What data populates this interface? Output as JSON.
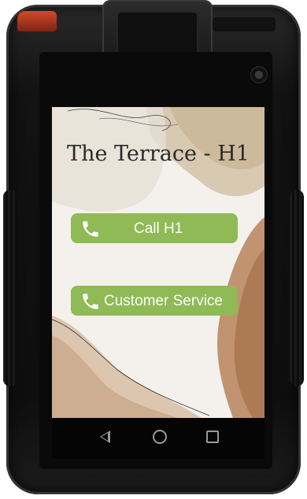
{
  "app": {
    "title": "The Terrace - H1"
  },
  "buttons": [
    {
      "label": "Call H1",
      "icon": "phone-icon"
    },
    {
      "label": "Customer Service",
      "icon": "phone-icon"
    }
  ],
  "colors": {
    "button_bg": "#8fba55",
    "button_text": "#ffffff",
    "title_text": "#2a2a2a"
  },
  "navigation": {
    "icons": [
      "back-icon",
      "home-icon",
      "recents-icon"
    ]
  }
}
